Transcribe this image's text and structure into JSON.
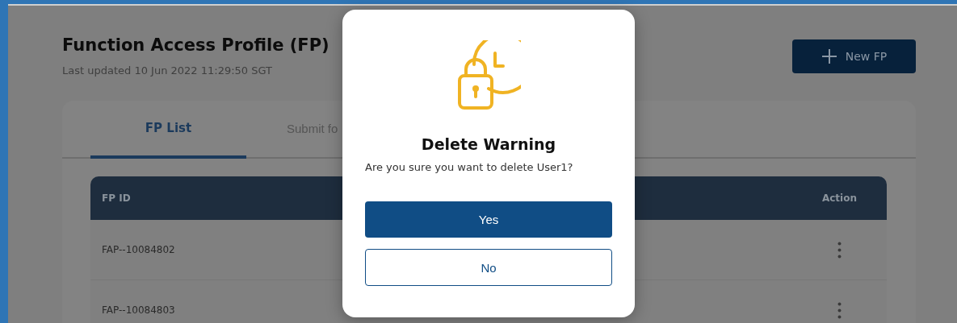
{
  "page": {
    "title": "Function Access Profile (FP)",
    "subtitle": "Last updated 10 Jun 2022 11:29:50 SGT",
    "new_button": "New FP"
  },
  "tabs": [
    {
      "label": "FP List",
      "selected": true
    },
    {
      "label": "Submit fo",
      "selected": false
    }
  ],
  "table": {
    "columns": [
      "FP ID",
      "Action"
    ],
    "rows": [
      {
        "fp_id": "FAP--10084802"
      },
      {
        "fp_id": "FAP--10084803"
      }
    ]
  },
  "dialog": {
    "title": "Delete Warning",
    "message": "Are you sure you want to delete User1?",
    "buttons": [
      {
        "label": "Yes",
        "kind": "primary"
      },
      {
        "label": "No",
        "kind": "secondary"
      }
    ]
  }
}
